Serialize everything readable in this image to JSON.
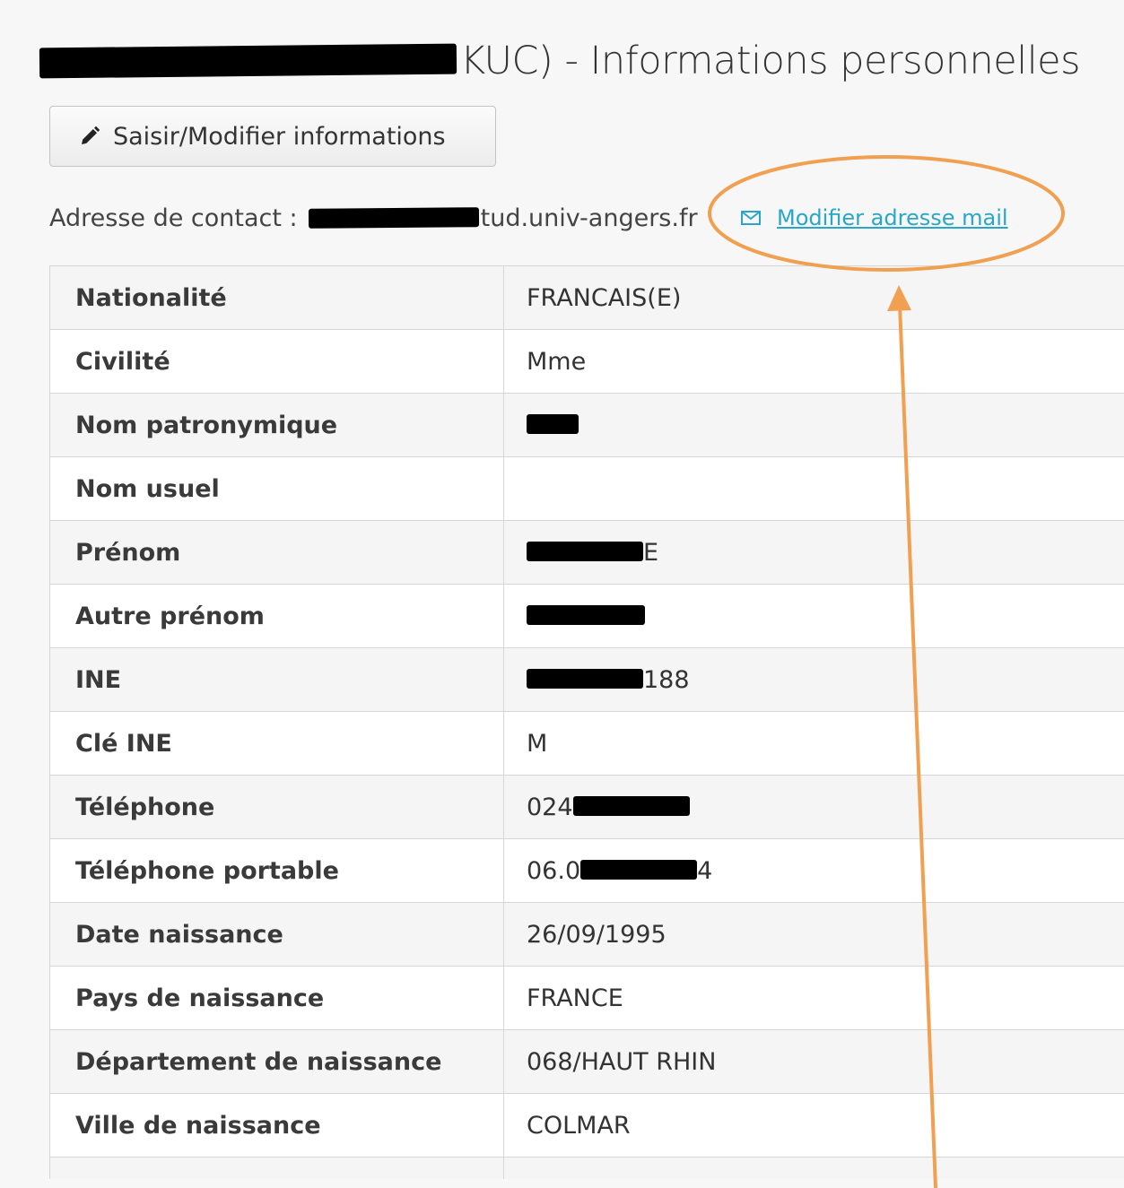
{
  "page": {
    "title": "KUC) - Informations personnelles"
  },
  "toolbar": {
    "edit_label": "Saisir/Modifier informations",
    "edit_icon": "pencil-icon"
  },
  "contact": {
    "label": "Adresse de contact :",
    "email_visible_part": "tud.univ-angers.fr",
    "modify_link": "Modifier adresse mail",
    "modify_icon": "envelope-icon"
  },
  "info": {
    "rows": [
      {
        "label": "Nationalité",
        "value": "FRANCAIS(E)"
      },
      {
        "label": "Civilité",
        "value": "Mme"
      },
      {
        "label": "Nom patronymique",
        "value": ""
      },
      {
        "label": "Nom usuel",
        "value": ""
      },
      {
        "label": "Prénom",
        "value": "E"
      },
      {
        "label": "Autre prénom",
        "value": ""
      },
      {
        "label": "INE",
        "value": "188"
      },
      {
        "label": "Clé INE",
        "value": "M"
      },
      {
        "label": "Téléphone",
        "value": "024"
      },
      {
        "label": "Téléphone portable",
        "value_prefix": "06.0",
        "value_suffix": "4"
      },
      {
        "label": "Date naissance",
        "value": "26/09/1995"
      },
      {
        "label": "Pays de naissance",
        "value": "FRANCE"
      },
      {
        "label": "Département de naissance",
        "value": "068/HAUT RHIN"
      },
      {
        "label": "Ville de naissance",
        "value": "COLMAR"
      }
    ]
  },
  "colors": {
    "link": "#2aa6c8",
    "annotation": "#f0a050",
    "redaction": "#000000"
  }
}
